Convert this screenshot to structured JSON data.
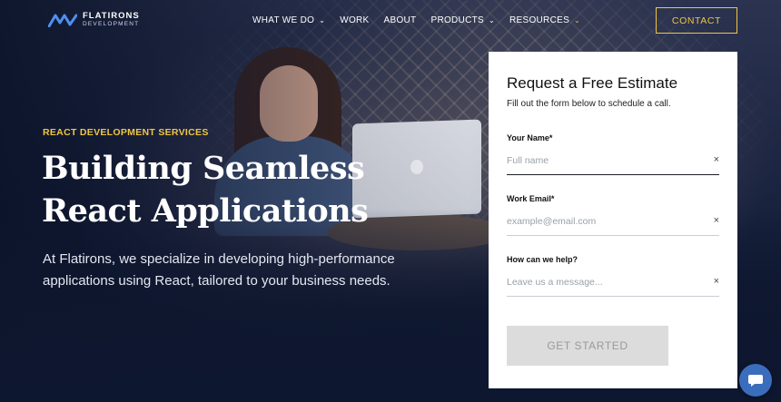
{
  "brand": {
    "name_line1": "FLATIRONS",
    "name_line2": "DEVELOPMENT",
    "accent": "#f2c542",
    "logo_color": "#4f8ff0"
  },
  "nav": {
    "items": [
      {
        "label": "WHAT WE DO",
        "dropdown": true
      },
      {
        "label": "WORK",
        "dropdown": false
      },
      {
        "label": "ABOUT",
        "dropdown": false
      },
      {
        "label": "PRODUCTS",
        "dropdown": true
      },
      {
        "label": "RESOURCES",
        "dropdown": true
      }
    ],
    "contact_label": "CONTACT"
  },
  "hero": {
    "eyebrow": "REACT DEVELOPMENT SERVICES",
    "headline_line1": "Building Seamless",
    "headline_line2": "React Applications",
    "subtext": "At Flatirons, we specialize in developing high-performance applications using React, tailored to your business needs."
  },
  "form": {
    "title": "Request a Free Estimate",
    "subtitle": "Fill out the form below to schedule a call.",
    "fields": [
      {
        "label": "Your Name*",
        "placeholder": "Full name",
        "value": ""
      },
      {
        "label": "Work Email*",
        "placeholder": "example@email.com",
        "value": ""
      },
      {
        "label": "How can we help?",
        "placeholder": "Leave us a message...",
        "value": ""
      }
    ],
    "clear_glyph": "×",
    "submit_label": "GET STARTED"
  },
  "chat": {
    "icon": "chat-bubble-icon",
    "color": "#3b6dbd"
  }
}
